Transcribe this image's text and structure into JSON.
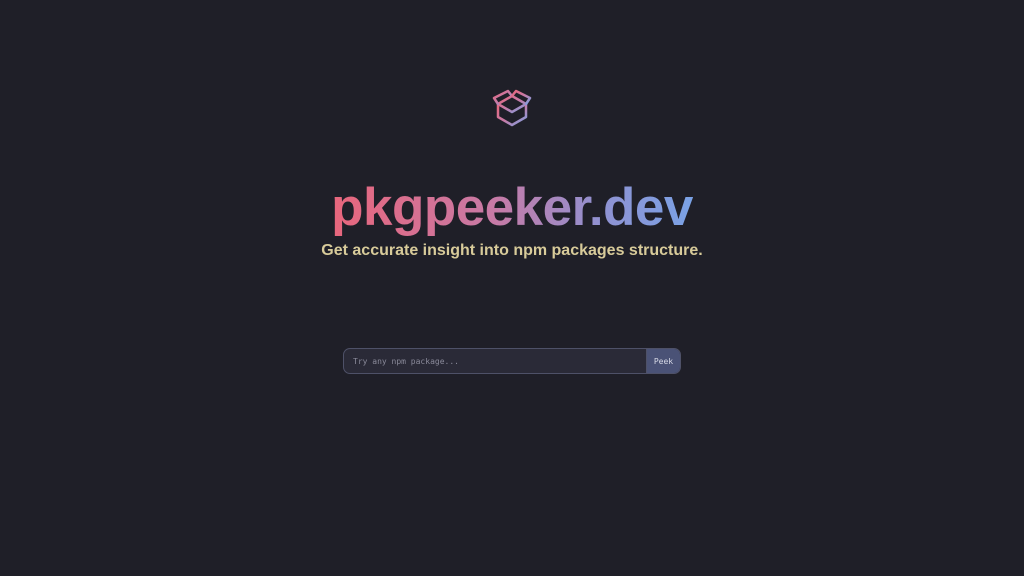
{
  "brand": {
    "title": "pkgpeeker.dev",
    "logo_icon": "open-box-icon",
    "gradient_colors": [
      "#e8667c",
      "#c77aa6",
      "#8f92d2",
      "#7aa2e6"
    ]
  },
  "hero": {
    "tagline": "Get accurate insight into npm packages structure."
  },
  "search": {
    "placeholder": "Try any npm package...",
    "value": "",
    "button_label": "Peek"
  },
  "colors": {
    "background": "#1f1f28",
    "tagline": "#d8cb9a",
    "button_bg": "#4a5276"
  }
}
